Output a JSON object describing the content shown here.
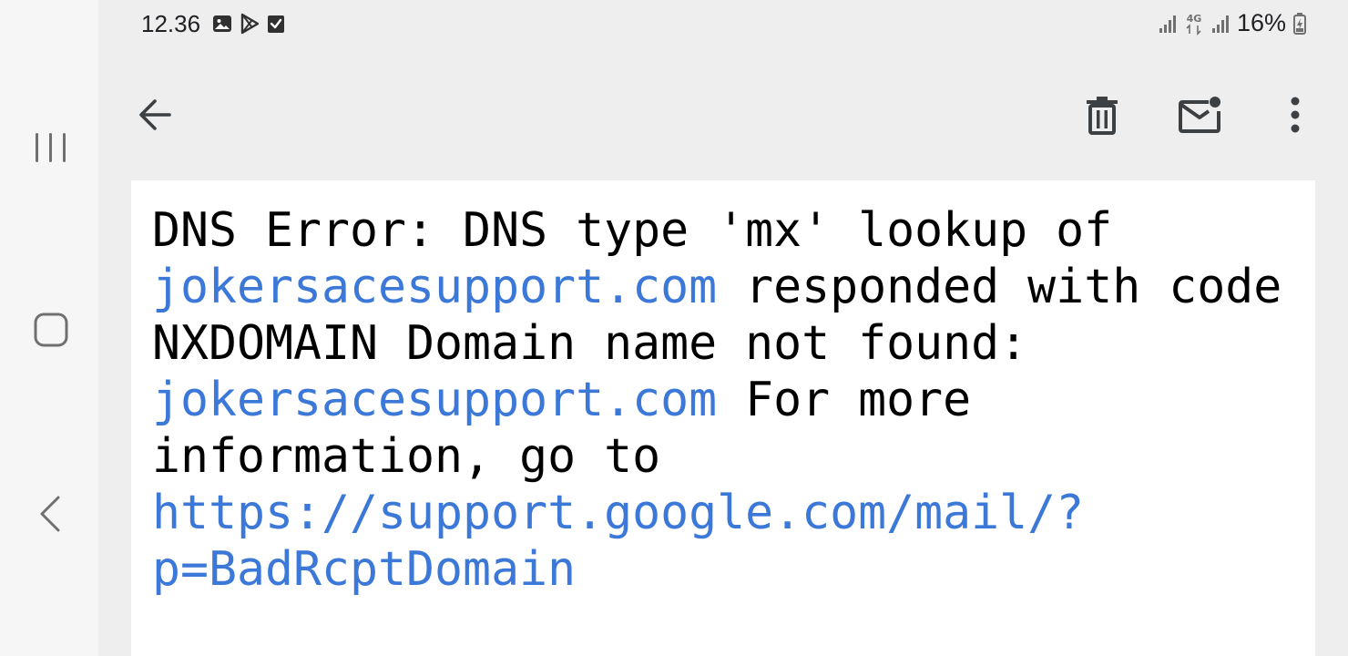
{
  "status_bar": {
    "time": "12.36",
    "notification_icons": [
      "image-icon",
      "play-store-icon",
      "checkbox-icon"
    ],
    "network": "4G",
    "battery": "16%"
  },
  "toolbar": {
    "back_icon": "arrow-left-icon",
    "delete_icon": "trash-icon",
    "mark_unread_icon": "mail-unread-icon",
    "more_icon": "more-vert-icon"
  },
  "message": {
    "line1": "DNS Error: DNS type 'mx' lookup of",
    "link1": "jokersacesupport.com",
    "text2": " responded with code NXDOMAIN Domain name not found: ",
    "link2": "jokersacesupport.com",
    "text3": " For more information, go to ",
    "link3": "https://support.google.com/mail/?p=BadRcptDomain"
  },
  "colors": {
    "link": "#3b78d8",
    "text": "#000000",
    "background": "#eeeeee"
  }
}
